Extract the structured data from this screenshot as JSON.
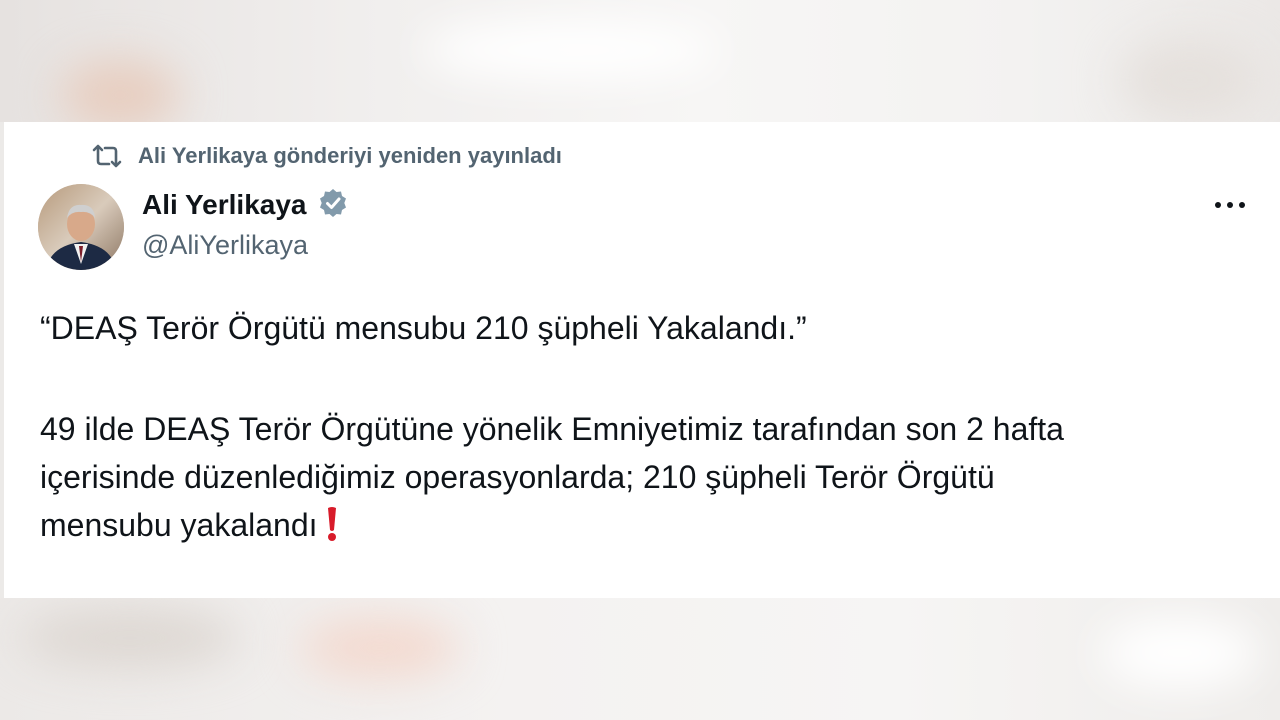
{
  "repost": {
    "icon": "repost-icon",
    "text": "Ali Yerlikaya gönderiyi yeniden yayınladı"
  },
  "author": {
    "avatar_icon": "avatar",
    "name": "Ali Yerlikaya",
    "verified_icon": "verified-badge-icon",
    "handle": "@AliYerlikaya"
  },
  "more_icon": "more-options-icon",
  "tweet": {
    "title_line": "“DEAŞ Terör Örgütü mensubu 210 şüpheli Yakalandı.”",
    "body_lines": [
      "49 ilde DEAŞ Terör Örgütüne yönelik Emniyetimiz tarafından son 2 hafta",
      "içerisinde düzenlediğimiz operasyonlarda; 210 şüpheli Terör Örgütü",
      "mensubu yakalandı"
    ],
    "emoji_icon": "red-exclamation-icon"
  },
  "colors": {
    "text_primary": "#0f1419",
    "text_secondary": "#536471",
    "verified_badge": "#829aab",
    "exclamation": "#d81b2a"
  }
}
